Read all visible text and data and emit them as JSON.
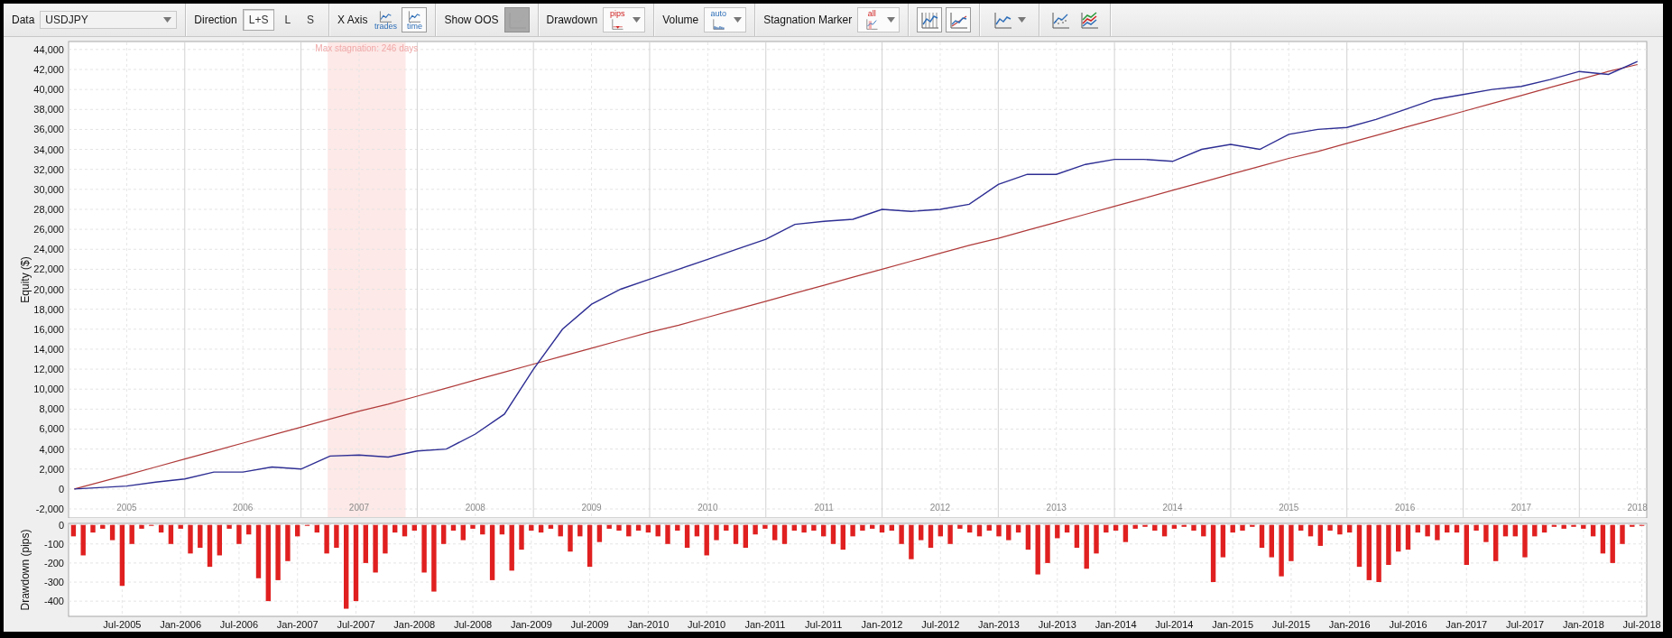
{
  "toolbar": [
    {
      "kind": "dropdown",
      "label": "Data",
      "value": "USDJPY"
    },
    {
      "kind": "toggles",
      "label": "Direction",
      "options": [
        {
          "text": "L+S",
          "selected": true
        },
        {
          "text": "L",
          "selected": false
        },
        {
          "text": "S",
          "selected": false
        }
      ]
    },
    {
      "kind": "icons",
      "label": "X Axis",
      "options": [
        {
          "text": "trades",
          "selected": false
        },
        {
          "text": "time",
          "selected": true
        }
      ]
    },
    {
      "kind": "switch",
      "label": "Show OOS",
      "disabled": true
    },
    {
      "kind": "icon-dropdown",
      "label": "Drawdown",
      "text": "pips"
    },
    {
      "kind": "icon-dropdown",
      "label": "Volume",
      "text": "auto"
    },
    {
      "kind": "icon-dropdown",
      "label": "Stagnation Marker",
      "text": "all"
    },
    {
      "kind": "icons",
      "options": [
        {
          "selected": true
        },
        {
          "selected": true
        }
      ]
    },
    {
      "kind": "icon-dropdown"
    },
    {
      "kind": "icons",
      "options": [
        {
          "selected": false
        },
        {
          "selected": false
        }
      ]
    }
  ],
  "equity_chart": {
    "chart_data": {
      "type": "line",
      "ylabel": "Equity ($)",
      "grid": true,
      "xlim": [
        2004.5,
        2018.08
      ],
      "ylim": [
        -2900,
        44800
      ],
      "yticks": [
        {
          "value": -2000,
          "label": "-2,000"
        },
        0,
        {
          "value": 2000,
          "label": "2,000"
        },
        {
          "value": 4000,
          "label": "4,000"
        },
        {
          "value": 6000,
          "label": "6,000"
        },
        {
          "value": 8000,
          "label": "8,000"
        },
        {
          "value": 10000,
          "label": "10,000"
        },
        {
          "value": 12000,
          "label": "12,000"
        },
        {
          "value": 14000,
          "label": "14,000"
        },
        {
          "value": 16000,
          "label": "16,000"
        },
        {
          "value": 18000,
          "label": "18,000"
        },
        {
          "value": 20000,
          "label": "20,000"
        },
        {
          "value": 22000,
          "label": "22,000"
        },
        {
          "value": 24000,
          "label": "24,000"
        },
        {
          "value": 26000,
          "label": "26,000"
        },
        {
          "value": 28000,
          "label": "28,000"
        },
        {
          "value": 30000,
          "label": "30,000"
        },
        {
          "value": 32000,
          "label": "32,000"
        },
        {
          "value": 34000,
          "label": "34,000"
        },
        {
          "value": 36000,
          "label": "36,000"
        },
        {
          "value": 38000,
          "label": "38,000"
        },
        {
          "value": 40000,
          "label": "40,000"
        },
        {
          "value": 42000,
          "label": "42,000"
        },
        {
          "value": 44000,
          "label": "44,000"
        }
      ],
      "xticks": [
        2005,
        2006,
        2007,
        2008,
        2009,
        2010,
        2011,
        2012,
        2013,
        2014,
        2015,
        2016,
        2017,
        2018
      ],
      "x": [
        2004.55,
        2005,
        2005.25,
        2005.5,
        2005.75,
        2006,
        2006.25,
        2006.5,
        2006.75,
        2007,
        2007.25,
        2007.5,
        2007.75,
        2008,
        2008.25,
        2008.5,
        2008.75,
        2009,
        2009.25,
        2009.5,
        2009.75,
        2010,
        2010.25,
        2010.5,
        2010.75,
        2011,
        2011.25,
        2011.5,
        2011.75,
        2012,
        2012.25,
        2012.5,
        2012.75,
        2013,
        2013.25,
        2013.5,
        2013.75,
        2014,
        2014.25,
        2014.5,
        2014.75,
        2015,
        2015.25,
        2015.5,
        2015.75,
        2016,
        2016.25,
        2016.5,
        2016.75,
        2017,
        2017.25,
        2017.5,
        2017.75,
        2018
      ],
      "series": [
        {
          "color": "#2e2e94",
          "values": [
            0,
            300,
            700,
            1000,
            1700,
            1700,
            2200,
            2000,
            3300,
            3400,
            3200,
            3800,
            4000,
            5500,
            7500,
            12000,
            16000,
            18500,
            20000,
            21000,
            22000,
            23000,
            24000,
            25000,
            26500,
            26800,
            27000,
            28000,
            27800,
            28000,
            28500,
            30500,
            31500,
            31500,
            32500,
            33000,
            33000,
            32800,
            34000,
            34500,
            34000,
            35500,
            36000,
            36200,
            37000,
            38000,
            39000,
            39500,
            40000,
            40300,
            41000,
            41800,
            41500,
            42800
          ]
        },
        {
          "color": "#b03a3a",
          "values": [
            0,
            1400,
            2200,
            3000,
            3800,
            4600,
            5400,
            6200,
            7000,
            7800,
            8500,
            9300,
            10100,
            10900,
            11700,
            12500,
            13300,
            14100,
            14900,
            15700,
            16400,
            17200,
            18000,
            18800,
            19600,
            20400,
            21200,
            22000,
            22800,
            23600,
            24400,
            25100,
            25900,
            26700,
            27500,
            28300,
            29100,
            29900,
            30700,
            31500,
            32300,
            33100,
            33800,
            34600,
            35400,
            36200,
            37000,
            37800,
            38600,
            39400,
            40200,
            41000,
            41800,
            42500
          ]
        }
      ],
      "bands": [
        {
          "axis": "x",
          "from": 2006.73,
          "to": 2007.4,
          "color": "#fde9e7",
          "label": "Max stagnation: 246 days"
        }
      ]
    }
  },
  "drawdown_chart": {
    "chart_data": {
      "type": "bar",
      "ylabel": "Drawdown (pips)",
      "grid": true,
      "ylim": [
        -480,
        8
      ],
      "yticks": [
        -400,
        -300,
        -200,
        -100,
        0
      ],
      "categories": [
        null,
        null,
        null,
        null,
        null,
        "Jul-2005",
        null,
        null,
        null,
        null,
        null,
        "Jan-2006",
        null,
        null,
        null,
        null,
        null,
        "Jul-2006",
        null,
        null,
        null,
        null,
        null,
        "Jan-2007",
        null,
        null,
        null,
        null,
        null,
        "Jul-2007",
        null,
        null,
        null,
        null,
        null,
        "Jan-2008",
        null,
        null,
        null,
        null,
        null,
        "Jul-2008",
        null,
        null,
        null,
        null,
        null,
        "Jan-2009",
        null,
        null,
        null,
        null,
        null,
        "Jul-2009",
        null,
        null,
        null,
        null,
        null,
        "Jan-2010",
        null,
        null,
        null,
        null,
        null,
        "Jul-2010",
        null,
        null,
        null,
        null,
        null,
        "Jan-2011",
        null,
        null,
        null,
        null,
        null,
        "Jul-2011",
        null,
        null,
        null,
        null,
        null,
        "Jan-2012",
        null,
        null,
        null,
        null,
        null,
        "Jul-2012",
        null,
        null,
        null,
        null,
        null,
        "Jan-2013",
        null,
        null,
        null,
        null,
        null,
        "Jul-2013",
        null,
        null,
        null,
        null,
        null,
        "Jan-2014",
        null,
        null,
        null,
        null,
        null,
        "Jul-2014",
        null,
        null,
        null,
        null,
        null,
        "Jan-2015",
        null,
        null,
        null,
        null,
        null,
        "Jul-2015",
        null,
        null,
        null,
        null,
        null,
        "Jan-2016",
        null,
        null,
        null,
        null,
        null,
        "Jul-2016",
        null,
        null,
        null,
        null,
        null,
        "Jan-2017",
        null,
        null,
        null,
        null,
        null,
        "Jul-2017",
        null,
        null,
        null,
        null,
        null,
        "Jan-2018",
        null,
        null,
        null,
        null,
        null,
        "Jul-2018"
      ],
      "series": [
        {
          "color": "#e02020",
          "values": [
            -60,
            -160,
            -40,
            -20,
            -80,
            -320,
            -100,
            -20,
            -5,
            -40,
            -100,
            -20,
            -150,
            -120,
            -220,
            -160,
            -20,
            -100,
            -50,
            -280,
            -400,
            -290,
            -190,
            -60,
            -5,
            -40,
            -150,
            -120,
            -440,
            -400,
            -200,
            -250,
            -150,
            -40,
            -60,
            -30,
            -250,
            -350,
            -100,
            -30,
            -80,
            -20,
            -50,
            -290,
            -50,
            -240,
            -130,
            -30,
            -40,
            -20,
            -60,
            -140,
            -60,
            -220,
            -90,
            -20,
            -30,
            -60,
            -30,
            -40,
            -60,
            -100,
            -30,
            -120,
            -60,
            -160,
            -80,
            -30,
            -100,
            -120,
            -50,
            -20,
            -80,
            -100,
            -30,
            -40,
            -30,
            -60,
            -100,
            -130,
            -60,
            -30,
            -20,
            -40,
            -30,
            -100,
            -180,
            -80,
            -120,
            -60,
            -100,
            -20,
            -40,
            -60,
            -30,
            -60,
            -80,
            -40,
            -130,
            -260,
            -200,
            -70,
            -40,
            -120,
            -230,
            -150,
            -40,
            -30,
            -90,
            -20,
            -10,
            -30,
            -60,
            -20,
            -10,
            -30,
            -60,
            -300,
            -170,
            -40,
            -30,
            -10,
            -120,
            -170,
            -270,
            -190,
            -30,
            -60,
            -110,
            -30,
            -50,
            -40,
            -220,
            -290,
            -300,
            -210,
            -140,
            -130,
            -40,
            -60,
            -80,
            -40,
            -40,
            -210,
            -30,
            -90,
            -190,
            -60,
            -60,
            -170,
            -60,
            -40,
            -10,
            -20,
            -10,
            -20,
            -60,
            -150,
            -200,
            -100,
            -10,
            -5
          ]
        }
      ]
    }
  }
}
